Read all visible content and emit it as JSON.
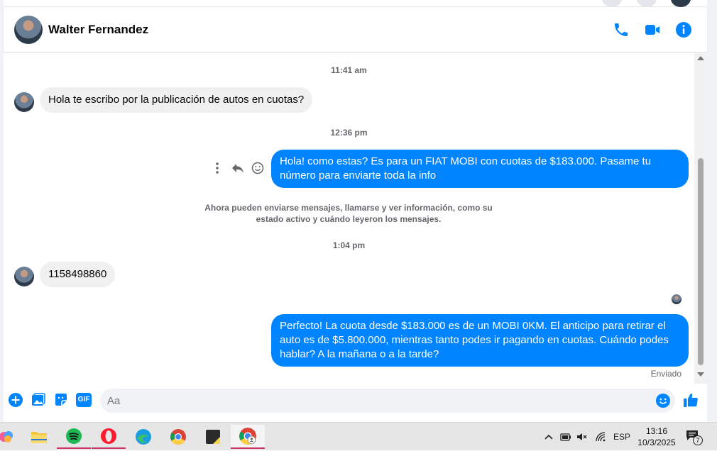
{
  "contact": {
    "name": "Walter Fernandez"
  },
  "header_icons": [
    "phone-icon",
    "video-icon",
    "info-icon"
  ],
  "colors": {
    "accent": "#0084ff",
    "incoming_bubble": "#f0f0f0",
    "muted_text": "#65676b"
  },
  "messages": [
    {
      "type": "timestamp",
      "text": "11:41 am"
    },
    {
      "type": "incoming",
      "text": "Hola te escribo por la publicación de autos en cuotas?"
    },
    {
      "type": "timestamp",
      "text": "12:36 pm"
    },
    {
      "type": "outgoing",
      "text": "Hola! como estas? Es para un FIAT MOBI con cuotas de $183.000. Pasame tu número para enviarte toda la info"
    },
    {
      "type": "notice",
      "text": "Ahora pueden enviarse mensajes, llamarse y ver información, como su estado activo y cuándo leyeron los mensajes."
    },
    {
      "type": "timestamp",
      "text": "1:04 pm"
    },
    {
      "type": "incoming",
      "text": "1158498860"
    },
    {
      "type": "outgoing",
      "text": "Perfecto! La cuota desde $183.000 es de un MOBI 0KM. El anticipo para retirar el auto es de $5.800.000, mientras tanto podes ir pagando en cuotas. Cuándo podes hablar? A la mañana o a la tarde?"
    }
  ],
  "status": {
    "sent_label": "Enviado"
  },
  "composer": {
    "placeholder": "Aa",
    "gif_label": "GIF"
  },
  "taskbar": {
    "apps": [
      "copilot-icon",
      "file-explorer-icon",
      "spotify-icon",
      "opera-icon",
      "edge-icon",
      "chrome-icon",
      "sticky-notes-icon",
      "chrome-profile-icon"
    ],
    "language": "ESP",
    "time": "13:16",
    "date": "10/3/2025",
    "notifications_count": "7"
  }
}
